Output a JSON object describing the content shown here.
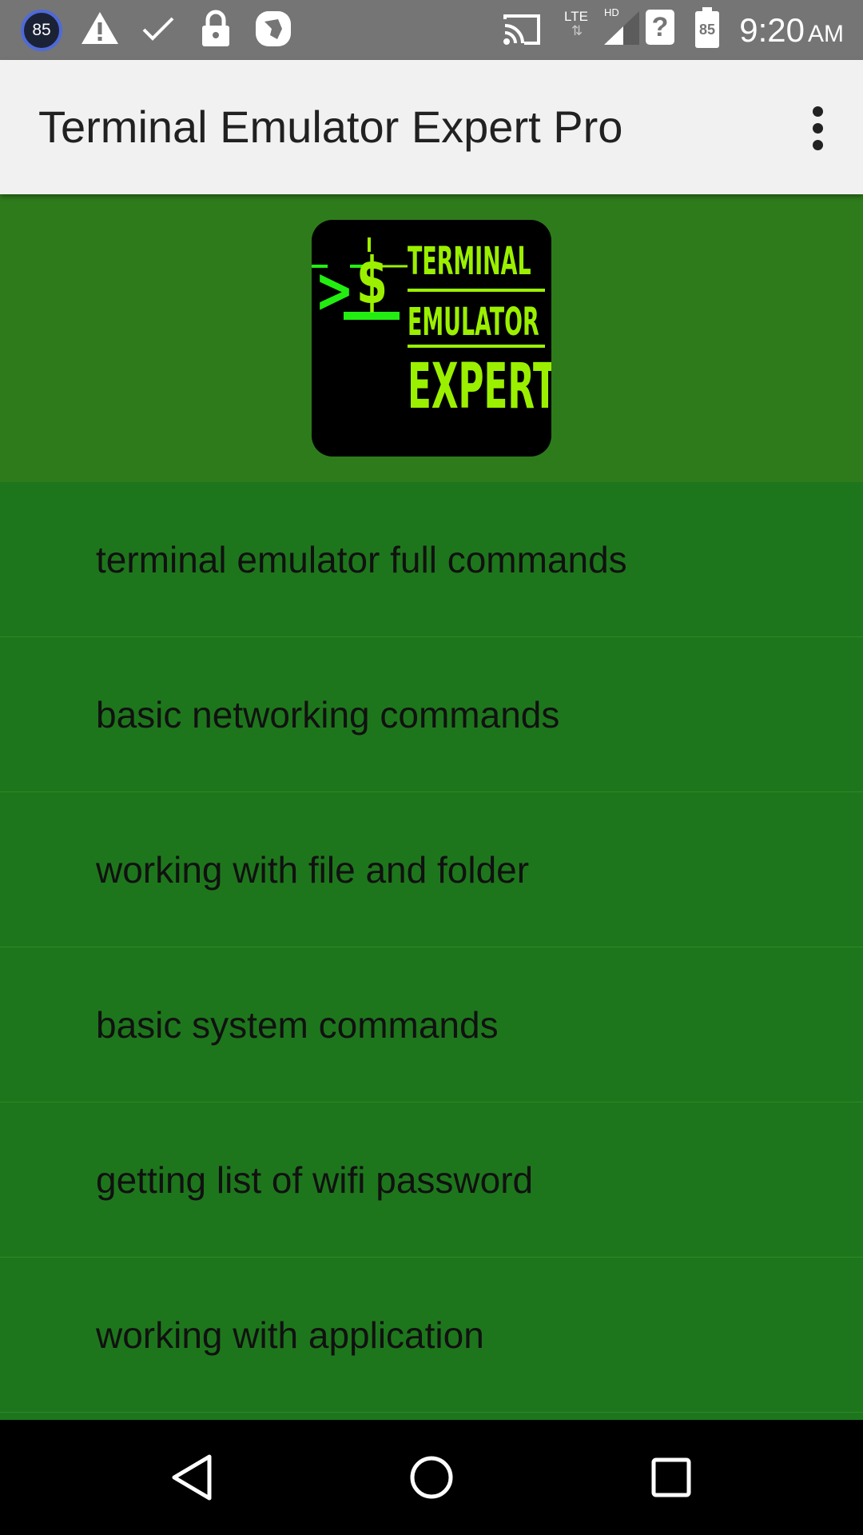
{
  "status_bar": {
    "badge_count": "85",
    "network_type": "LTE",
    "network_arrows": "⇅",
    "hd_label": "HD",
    "unknown_sim": "?",
    "battery_level": "85",
    "time": "9:20",
    "ampm": "AM",
    "icons": [
      "notification-badge",
      "warning-icon",
      "check-icon",
      "lock-icon",
      "app-notification-icon",
      "cast-icon",
      "signal-icon",
      "sim-unknown-icon",
      "battery-icon"
    ]
  },
  "app_bar": {
    "title": "Terminal Emulator Expert Pro",
    "overflow_icon": "more-vert-icon"
  },
  "logo": {
    "prompt_symbol": ">",
    "dollar_symbol": "$",
    "line1": "TERMINAL",
    "line2": "EMULATOR",
    "line3": "EXPERT",
    "accent_color": "#9bf000",
    "prompt_color": "#22ee11"
  },
  "menu": {
    "items": [
      {
        "label": "terminal emulator full commands"
      },
      {
        "label": "basic networking commands"
      },
      {
        "label": "working with file and folder"
      },
      {
        "label": "basic system commands"
      },
      {
        "label": "getting list of wifi password"
      },
      {
        "label": "working with application"
      }
    ]
  },
  "nav_bar": {
    "buttons": [
      "back-icon",
      "home-icon",
      "recents-icon"
    ]
  },
  "colors": {
    "status_bar_bg": "#757575",
    "app_bar_bg": "#f1f1f1",
    "header_bg": "#2e7b1c",
    "list_bg": "#1e761c",
    "nav_bar_bg": "#000000"
  }
}
